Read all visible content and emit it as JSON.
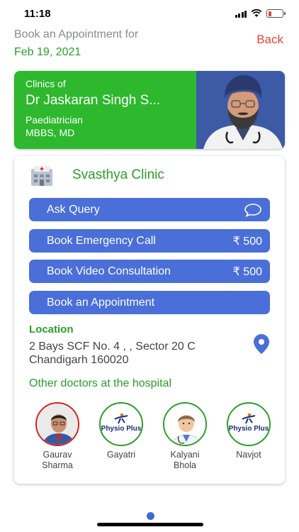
{
  "status_bar": {
    "time": "11:18"
  },
  "header": {
    "label": "Book an Appointment for",
    "date": "Feb 19, 2021",
    "back_label": "Back"
  },
  "doctor": {
    "clinics_of": "Clinics of",
    "name": "Dr Jaskaran Singh S...",
    "specialty": "Paediatrician",
    "degree": "MBBS, MD"
  },
  "clinic": {
    "name": "Svasthya Clinic",
    "actions": [
      {
        "label": "Ask Query",
        "icon": "chat-bubble-icon"
      },
      {
        "label": "Book Emergency Call",
        "price": "₹ 500"
      },
      {
        "label": "Book Video Consultation",
        "price": "₹ 500"
      },
      {
        "label": "Book an Appointment"
      }
    ],
    "location_label": "Location",
    "address_line1": "2 Bays SCF No. 4 , , Sector 20 C",
    "address_line2": "Chandigarh 160020",
    "other_doctors_label": "Other doctors at the hospital",
    "other_doctors": [
      {
        "name_line1": "Gaurav",
        "name_line2": "Sharma"
      },
      {
        "name_line1": "Gayatri",
        "name_line2": "",
        "logo_text": "Physio Plus"
      },
      {
        "name_line1": "Kalyani",
        "name_line2": "Bhola"
      },
      {
        "name_line1": "Navjot",
        "name_line2": "",
        "logo_text": "Physio Plus"
      }
    ]
  },
  "colors": {
    "primary_green": "#2db82d",
    "green_text": "#2a9d2a",
    "button_blue": "#4a6fd9",
    "back_red": "#e0453a",
    "avatar_border_red": "#d32020",
    "avatar_border_green": "#2a9d2a",
    "doctor_photo_bg": "#3c5aa6",
    "page_dot": "#3b6bd6"
  }
}
